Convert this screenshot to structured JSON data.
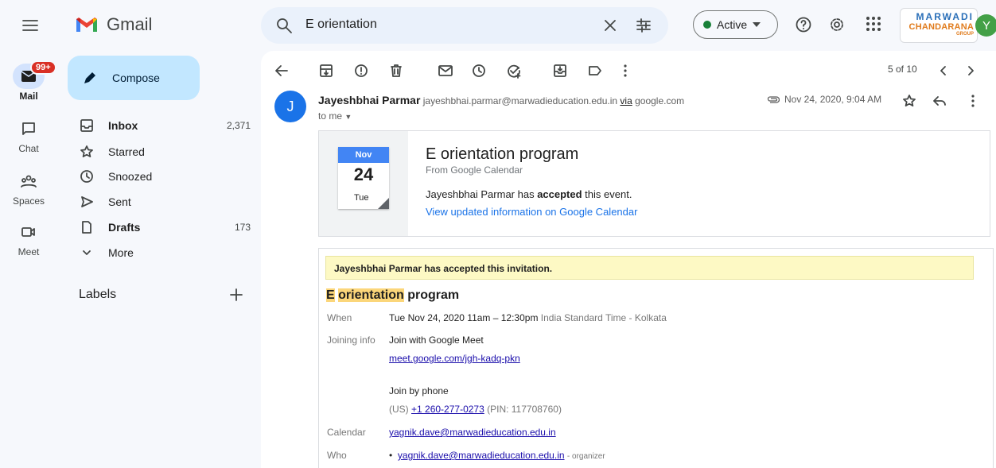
{
  "app": {
    "name": "Gmail"
  },
  "search": {
    "value": "E orientation"
  },
  "status": {
    "label": "Active",
    "color": "#188038"
  },
  "brand": {
    "line1": "MARWADI",
    "line2": "CHANDARANA",
    "line3": "GROUP"
  },
  "account": {
    "initial": "Y"
  },
  "rail": {
    "mail": "Mail",
    "mail_badge": "99+",
    "chat": "Chat",
    "spaces": "Spaces",
    "meet": "Meet"
  },
  "compose": {
    "label": "Compose"
  },
  "nav": [
    {
      "label": "Inbox",
      "count": "2,371",
      "icon": "inbox-icon"
    },
    {
      "label": "Starred",
      "count": "",
      "icon": "star-icon"
    },
    {
      "label": "Snoozed",
      "count": "",
      "icon": "clock-icon"
    },
    {
      "label": "Sent",
      "count": "",
      "icon": "send-icon"
    },
    {
      "label": "Drafts",
      "count": "173",
      "icon": "draft-icon"
    },
    {
      "label": "More",
      "count": "",
      "icon": "chevron-down-icon"
    }
  ],
  "labels": {
    "title": "Labels"
  },
  "pager": {
    "text": "5 of 10"
  },
  "message": {
    "sender_initial": "J",
    "sender_name": "Jayeshbhai Parmar",
    "sender_email": "jayeshbhai.parmar@marwadieducation.edu.in",
    "via_word": "via",
    "via_domain": "google.com",
    "to": "to me",
    "date": "Nov 24, 2020, 9:04 AM"
  },
  "calendar_card": {
    "month": "Nov",
    "day": "24",
    "weekday": "Tue",
    "title": "E orientation program",
    "from": "From Google Calendar",
    "accepted_prefix": "Jayeshbhai Parmar has ",
    "accepted_word": "accepted",
    "accepted_suffix": " this event.",
    "link": "View updated information on Google Calendar"
  },
  "invitation": {
    "banner": "Jayeshbhai Parmar has accepted this invitation.",
    "title_a": "E",
    "title_b": "orientation",
    "title_c": "program",
    "when_label": "When",
    "when_value": "Tue Nov 24, 2020 11am – 12:30pm",
    "when_tz": "India Standard Time - Kolkata",
    "joining_label": "Joining info",
    "join_meet": "Join with Google Meet",
    "meet_link": "meet.google.com/jgh-kadq-pkn",
    "join_phone": "Join by phone",
    "phone_prefix": "(US)",
    "phone_number": "+1 260-277-0273",
    "pin": "(PIN: 117708760)",
    "calendar_label": "Calendar",
    "calendar_value": "yagnik.dave@marwadieducation.edu.in",
    "who_label": "Who",
    "who_email": "yagnik.dave@marwadieducation.edu.in",
    "who_role": "- organizer"
  }
}
